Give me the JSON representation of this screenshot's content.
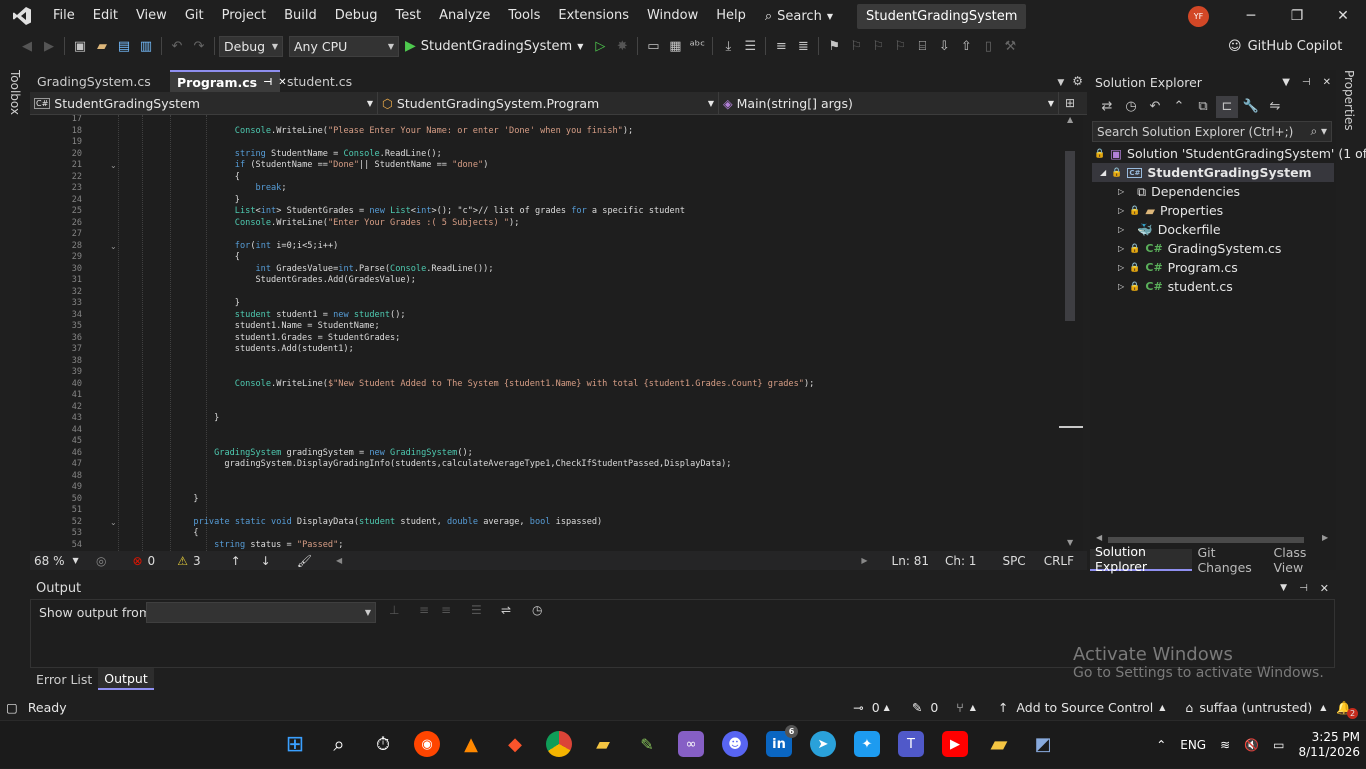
{
  "menubar": {
    "items": [
      "File",
      "Edit",
      "View",
      "Git",
      "Project",
      "Build",
      "Debug",
      "Test",
      "Analyze",
      "Tools",
      "Extensions",
      "Window",
      "Help"
    ],
    "search": "Search",
    "solution_name": "StudentGradingSystem",
    "avatar_initials": "YF"
  },
  "toolbar": {
    "config": "Debug",
    "platform": "Any CPU",
    "run_target": "StudentGradingSystem",
    "copilot": "GitHub Copilot"
  },
  "toolbox_label": "Toolbox",
  "properties_label": "Properties",
  "tabs": [
    {
      "label": "GradingSystem.cs"
    },
    {
      "label": "Program.cs"
    },
    {
      "label": "student.cs"
    }
  ],
  "navbar": {
    "project": "StudentGradingSystem",
    "class": "StudentGradingSystem.Program",
    "member": "Main(string[] args)"
  },
  "editor": {
    "lines": [
      {
        "n": "17",
        "t": ""
      },
      {
        "n": "18",
        "t": "                Console.WriteLine(\"Please Enter Your Name: or enter 'Done' when you finish\");"
      },
      {
        "n": "19",
        "t": ""
      },
      {
        "n": "20",
        "t": "                string StudentName = Console.ReadLine();"
      },
      {
        "n": "21",
        "t": "                if (StudentName ==\"Done\"|| StudentName == \"done\")"
      },
      {
        "n": "22",
        "t": "                {"
      },
      {
        "n": "23",
        "t": "                    break;"
      },
      {
        "n": "24",
        "t": "                }"
      },
      {
        "n": "25",
        "t": "                List<int> StudentGrades = new List<int>(); // list of grades for a specific student"
      },
      {
        "n": "26",
        "t": "                Console.WriteLine(\"Enter Your Grades :( 5 Subjects) \");"
      },
      {
        "n": "27",
        "t": ""
      },
      {
        "n": "28",
        "t": "                for(int i=0;i<5;i++)"
      },
      {
        "n": "29",
        "t": "                {"
      },
      {
        "n": "30",
        "t": "                    int GradesValue=int.Parse(Console.ReadLine());"
      },
      {
        "n": "31",
        "t": "                    StudentGrades.Add(GradesValue);"
      },
      {
        "n": "32",
        "t": ""
      },
      {
        "n": "33",
        "t": "                }"
      },
      {
        "n": "34",
        "t": "                student student1 = new student();"
      },
      {
        "n": "35",
        "t": "                student1.Name = StudentName;"
      },
      {
        "n": "36",
        "t": "                student1.Grades = StudentGrades;"
      },
      {
        "n": "37",
        "t": "                students.Add(student1);"
      },
      {
        "n": "38",
        "t": ""
      },
      {
        "n": "39",
        "t": ""
      },
      {
        "n": "40",
        "t": "                Console.WriteLine($\"New Student Added to The System {student1.Name} with total {student1.Grades.Count} grades\");"
      },
      {
        "n": "41",
        "t": ""
      },
      {
        "n": "42",
        "t": ""
      },
      {
        "n": "43",
        "t": "            }"
      },
      {
        "n": "44",
        "t": ""
      },
      {
        "n": "45",
        "t": ""
      },
      {
        "n": "46",
        "t": "            GradingSystem gradingSystem = new GradingSystem();"
      },
      {
        "n": "47",
        "t": "              gradingSystem.DisplayGradingInfo(students,calculateAverageType1,CheckIfStudentPassed,DisplayData);"
      },
      {
        "n": "48",
        "t": ""
      },
      {
        "n": "49",
        "t": ""
      },
      {
        "n": "50",
        "t": "        }"
      },
      {
        "n": "51",
        "t": ""
      },
      {
        "n": "52",
        "t": "        private static void DisplayData(student student, double average, bool ispassed)"
      },
      {
        "n": "53",
        "t": "        {"
      },
      {
        "n": "54",
        "t": "            string status = \"Passed\";"
      }
    ]
  },
  "edstatus": {
    "zoom": "68 %",
    "errors": "0",
    "warnings": "3",
    "line": "Ln: 81",
    "col": "Ch: 1",
    "spc": "SPC",
    "crlf": "CRLF"
  },
  "output": {
    "title": "Output",
    "show_from": "Show output from:",
    "source": ""
  },
  "bottom_tabs": [
    "Error List",
    "Output"
  ],
  "solution_explorer": {
    "title": "Solution Explorer",
    "search_placeholder": "Search Solution Explorer (Ctrl+;)",
    "solution": "Solution 'StudentGradingSystem' (1 of 1",
    "project": "StudentGradingSystem",
    "items": [
      "Dependencies",
      "Properties",
      "Dockerfile",
      "GradingSystem.cs",
      "Program.cs",
      "student.cs"
    ],
    "tabs": [
      "Solution Explorer",
      "Git Changes",
      "Class View"
    ]
  },
  "statusbar": {
    "ready": "Ready",
    "up_count": "0",
    "edit_count": "0",
    "source_control": "Add to Source Control",
    "repo": "suffaa (untrusted)",
    "notif": "2"
  },
  "activate": {
    "line1": "Activate Windows",
    "line2": "Go to Settings to activate Windows."
  },
  "taskbar": {
    "lang": "ENG",
    "time": "3:25 PM",
    "date": "8/11/2026",
    "linkedin_badge": "6"
  }
}
